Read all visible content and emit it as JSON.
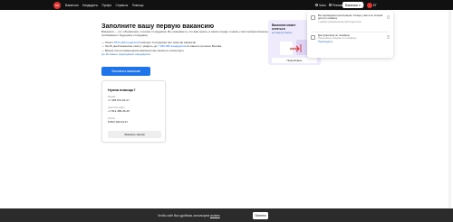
{
  "header": {
    "logo_text": "hh",
    "nav": [
      "Вакансии",
      "Кандидаты",
      "Профи",
      "Сервисы",
      "Помощь"
    ],
    "right_nav": [
      "Чаты",
      "Резюме",
      "Войти"
    ],
    "vacancies_button": "Вакансии",
    "profile_label": "ЕГ"
  },
  "main": {
    "title": "Заполните вашу первую вакансию",
    "intro": "Вакансия — это объявление о поиске сотрудника. Вы указываете, кто вам нужен, в каком городе и какие у вас профессиональные требования к будущему сотруднику",
    "bullets": [
      {
        "pre": "— Около ",
        "hl": "87% работодателей",
        "post": " находят сотрудника при помощи вакансии"
      },
      {
        "pre": "— За 30 дней вакансию смогут увидеть до ",
        "hl": "7 180 000 кандидатов",
        "post": " из вашего региона Москва"
      },
      {
        "pre": "— Время после размещения вакансии мы сможете посмотреть",
        "hl": "",
        "post": ""
      },
      {
        "pre": "",
        "hl": "до 10 самых подходящих кандидатов",
        "post": ""
      }
    ],
    "cta_label": "Заполнить вакансию"
  },
  "help": {
    "title": "Нужна помощь?",
    "contacts": [
      {
        "label": "Москва",
        "number": "+7 495 974-64-27"
      },
      {
        "label": "Санкт-Петербург",
        "number": "+7 812 458-45-45"
      },
      {
        "label": "Россия",
        "number": "8 800 100-64-27"
      }
    ],
    "call_button": "Заказать звонок"
  },
  "promo": {
    "title": "Вакансия может остаться",
    "subtitle": "не зацепу поиску",
    "try_button": "Попробовать"
  },
  "popover": {
    "items": [
      {
        "title": "Вы подтвердили регистрацию. Теперь у вас есть полный доступ к сервису",
        "sub": "с одним проверенным работодателем",
        "link": ""
      },
      {
        "title": "Доступна вход по телефону",
        "sub": "Пользуйтесь входом по телефону",
        "link": "Подтвердить"
      }
    ]
  },
  "cookie": {
    "text": "Чтобы сайт был удобным, используем",
    "link": "cookies",
    "button": "Понятно"
  }
}
